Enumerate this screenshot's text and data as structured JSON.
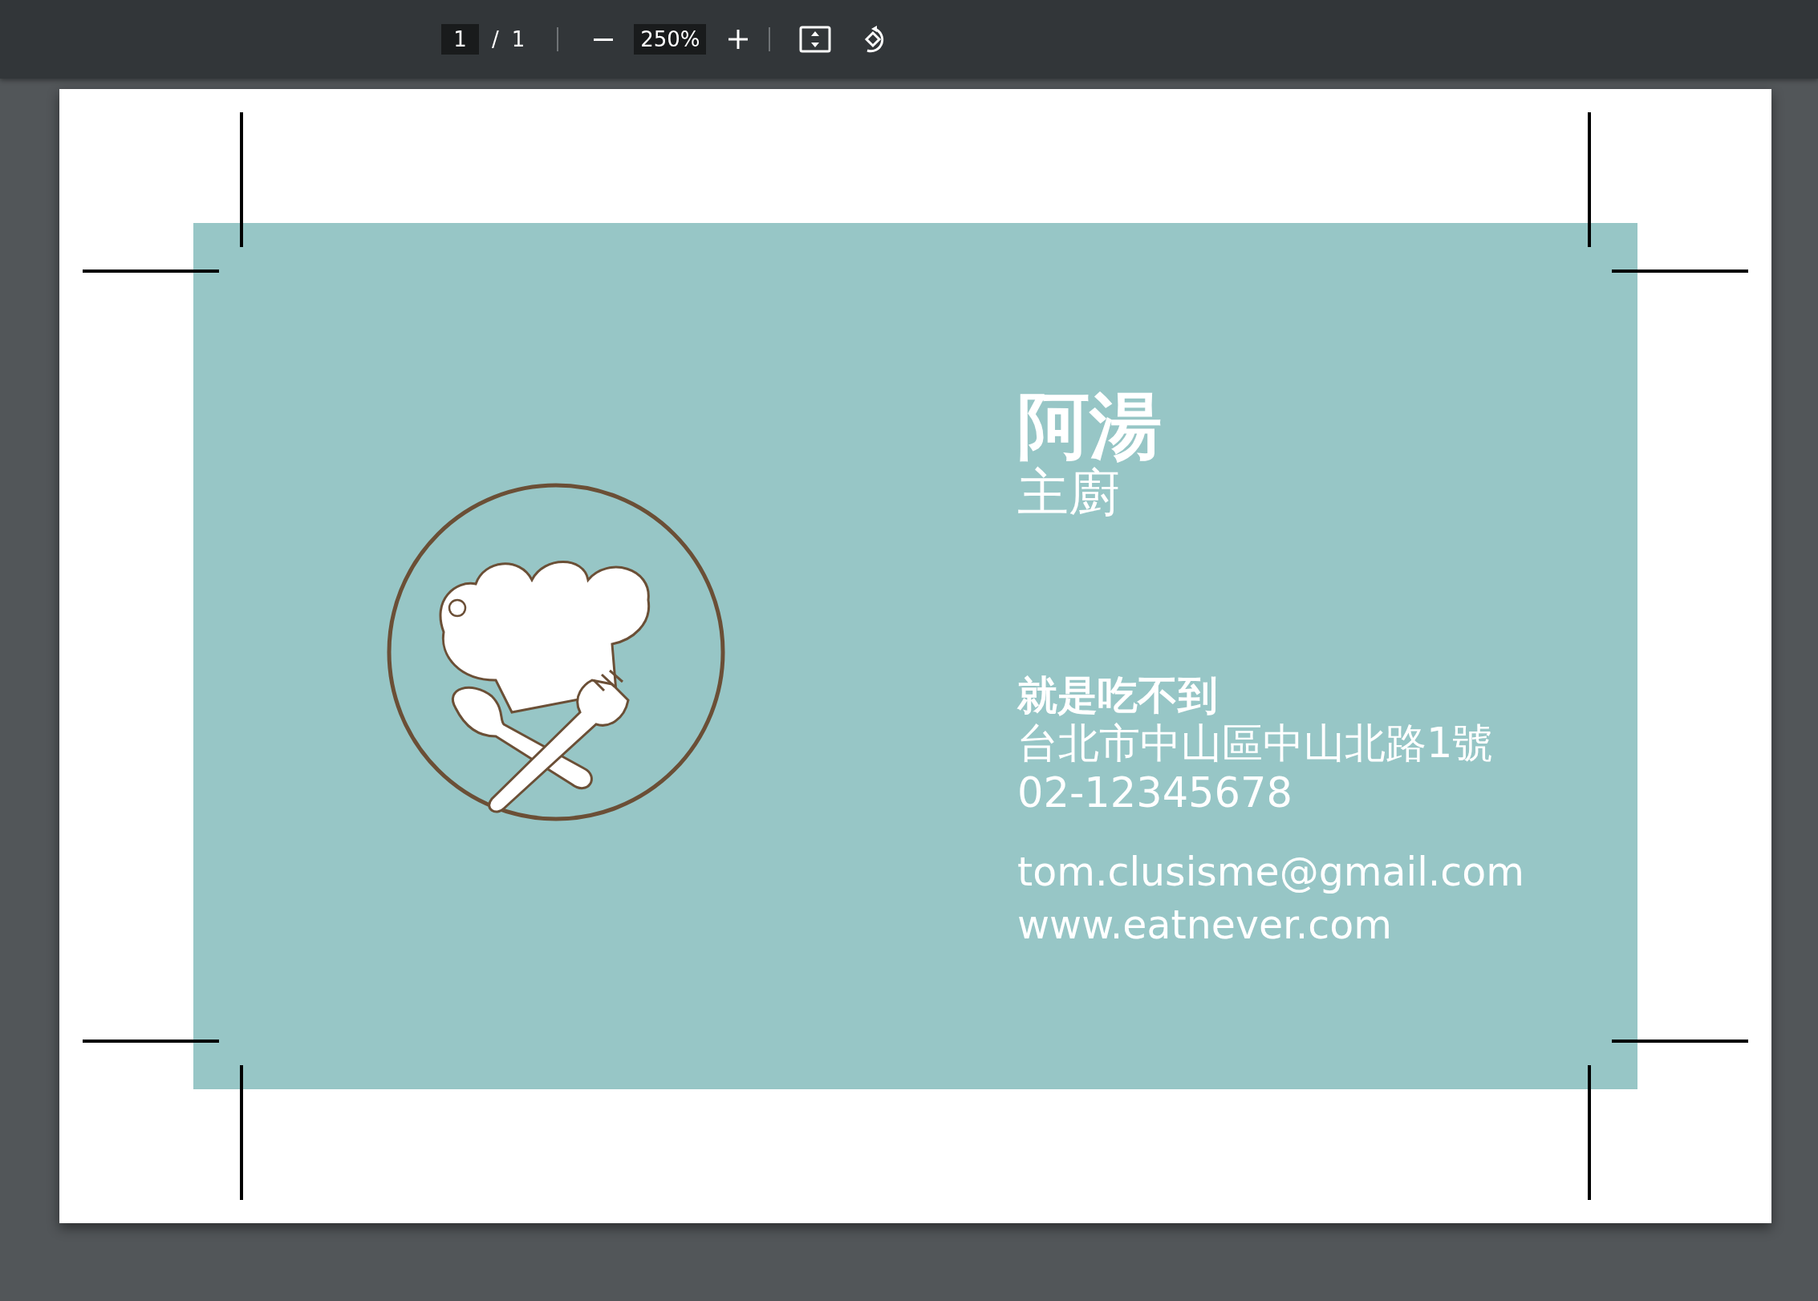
{
  "toolbar": {
    "page_number": "1",
    "page_separator": "/",
    "page_count": "1",
    "zoom": "250%"
  },
  "card": {
    "name": "阿湯",
    "title": "主廚",
    "company": "就是吃不到",
    "address": "台北市中山區中山北路1號",
    "phone": "02-12345678",
    "email": "tom.clusisme@gmail.com",
    "website": "www.eatnever.com"
  }
}
